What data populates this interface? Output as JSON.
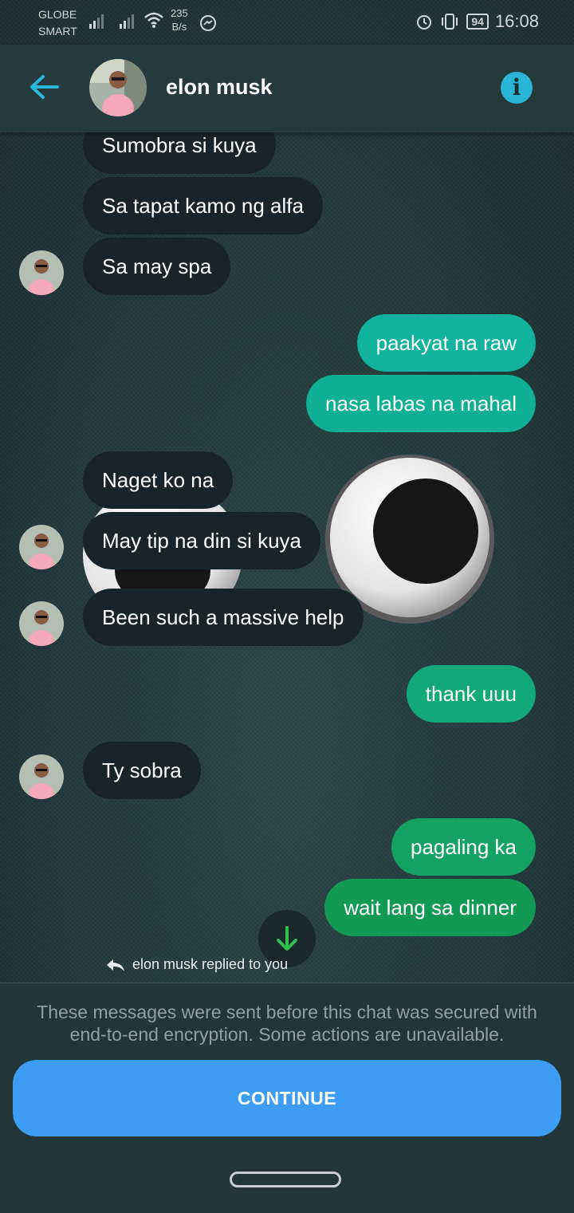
{
  "status_bar": {
    "carrier_line1": "GLOBE",
    "carrier_line2": "SMART",
    "speed_value": "235",
    "speed_unit": "B/s",
    "battery": "94",
    "time": "16:08"
  },
  "header": {
    "contact_name": "elon musk",
    "back_icon": "back-arrow-icon",
    "info_icon": "info-icon",
    "accent_color": "#29b6d8"
  },
  "messages": [
    {
      "from": "them",
      "text": "Sumobra si kuya"
    },
    {
      "from": "them",
      "text": "Sa tapat kamo ng alfa"
    },
    {
      "from": "them",
      "text": "Sa may spa"
    },
    {
      "from": "me",
      "text": "paakyat na raw"
    },
    {
      "from": "me",
      "text": "nasa labas na mahal"
    },
    {
      "from": "them",
      "text": "Naget ko na"
    },
    {
      "from": "them",
      "text": "May tip na din si kuya"
    },
    {
      "from": "them",
      "text": "Been such a massive help"
    },
    {
      "from": "me",
      "text": "thank uuu"
    },
    {
      "from": "them",
      "text": "Ty sobra"
    },
    {
      "from": "me",
      "text": "pagaling ka"
    },
    {
      "from": "me",
      "text": "wait lang sa dinner"
    }
  ],
  "reply_indicator": "elon musk replied to you",
  "footer": {
    "notice": "These messages were sent before this chat was secured with end-to-end encryption. Some actions are unavailable.",
    "continue_label": "CONTINUE"
  },
  "colors": {
    "incoming_bubble": "#17252a",
    "continue_button": "#3d9df2"
  }
}
